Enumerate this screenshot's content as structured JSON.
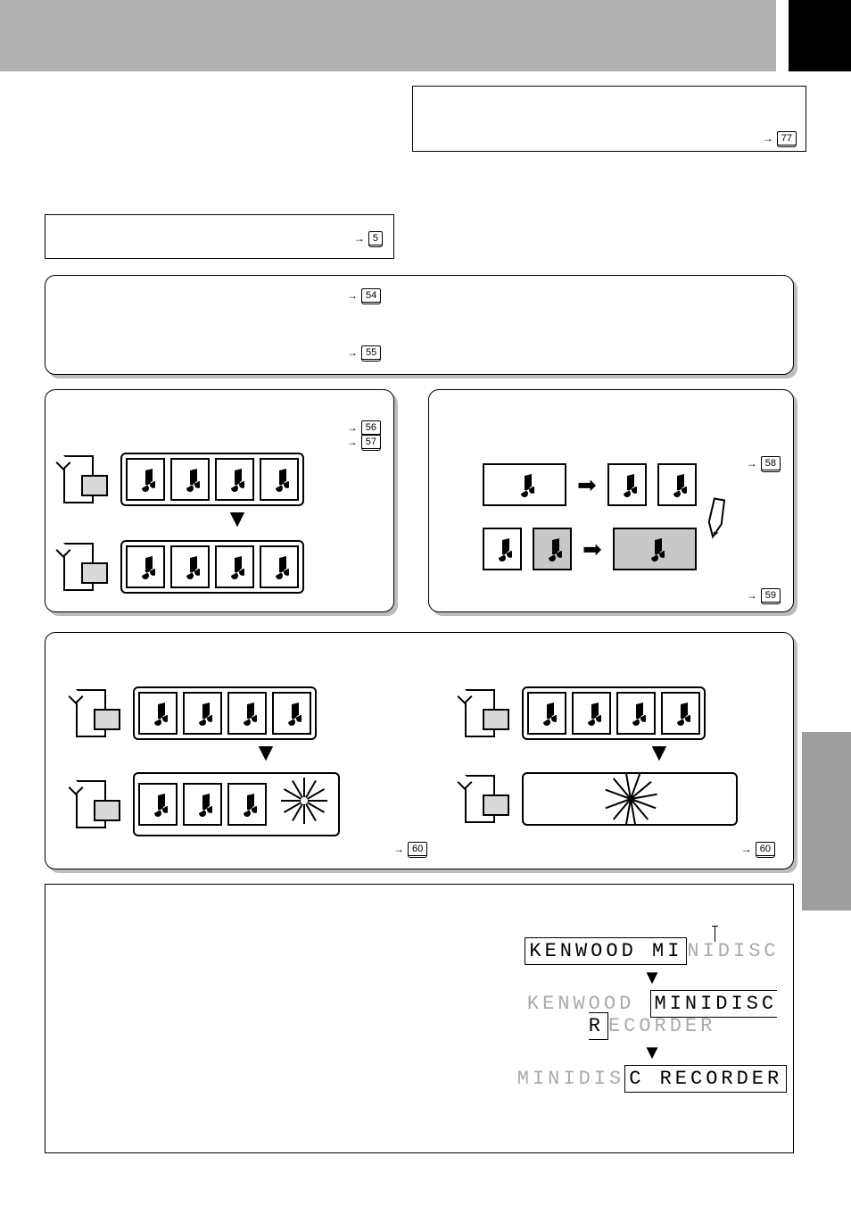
{
  "refs": {
    "top": "77",
    "box1": "5",
    "panel_top_a": "54",
    "panel_top_b": "55",
    "move_a": "56",
    "move_b": "57",
    "split_a": "58",
    "split_b": "59",
    "erase_a": "60",
    "erase_b": "60"
  },
  "title_display": {
    "line1_a": "KENWOOD MI",
    "line1_b": "NIDISC",
    "line2_a": "KENWOOD ",
    "line2_b": "MINIDISC R",
    "line2_c": "ECORDER",
    "line3_a": "MINIDIS",
    "line3_b": "C RECORDER"
  },
  "arrows": {
    "right": "➡",
    "down": "▼",
    "slim_down": "↓",
    "page_arrow": "→"
  }
}
